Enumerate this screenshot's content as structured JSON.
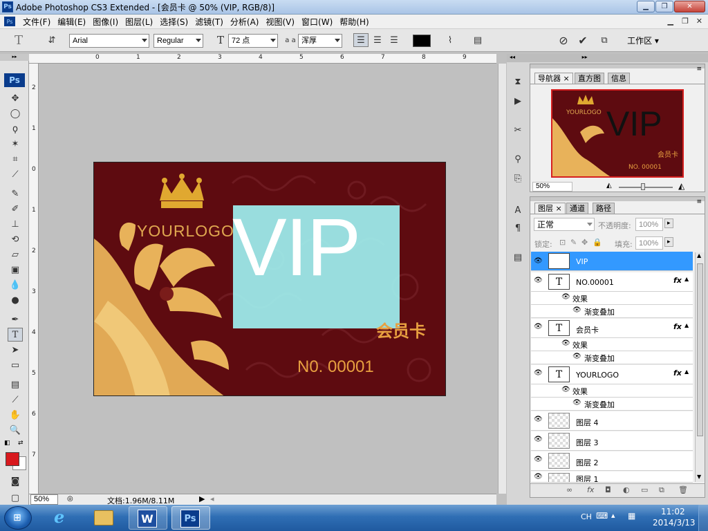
{
  "window": {
    "title": "Adobe Photoshop CS3 Extended - [会员卡 @ 50% (VIP, RGB/8)]",
    "app_icon": "Ps"
  },
  "menu": [
    "文件(F)",
    "编辑(E)",
    "图像(I)",
    "图层(L)",
    "选择(S)",
    "滤镜(T)",
    "分析(A)",
    "视图(V)",
    "窗口(W)",
    "帮助(H)"
  ],
  "options": {
    "tool_letter": "T",
    "font_family": "Arial",
    "font_style": "Regular",
    "font_size": "72 点",
    "aa_label": "a a",
    "anti_alias": "浑厚",
    "text_color": "#000000",
    "workspace": "工作区 ▾"
  },
  "canvas": {
    "zoom": "50%",
    "doc_size": "文档:1.96M/8.11M",
    "ruler_h": [
      "0",
      "1",
      "2",
      "3",
      "4",
      "5",
      "6",
      "7",
      "8",
      "9"
    ],
    "ruler_v": [
      "2",
      "1",
      "0",
      "1",
      "2",
      "3",
      "4",
      "5",
      "6",
      "7"
    ]
  },
  "card": {
    "logo": "YOURLOGO",
    "vip": "VIP",
    "member": "会员卡",
    "number": "N0. 00001",
    "bg_color": "#5e0b10",
    "gold": "#e8b25a",
    "highlight": "#9ef0f0"
  },
  "navigator": {
    "tabs": [
      "导航器",
      "直方图",
      "信息"
    ],
    "zoom": "50%",
    "preview": {
      "logo": "YOURLOGO",
      "vip": "VIP",
      "member": "会员卡",
      "number": "NO. 00001"
    }
  },
  "layers": {
    "tabs": [
      "图层",
      "通道",
      "路径"
    ],
    "blend_mode": "正常",
    "opacity_label": "不透明度:",
    "opacity": "100%",
    "lock_label": "锁定:",
    "fill_label": "填充:",
    "fill": "100%",
    "items": [
      {
        "name": "VIP",
        "type": "text",
        "selected": true
      },
      {
        "name": "NO.00001",
        "type": "text",
        "fx": "fx",
        "effects_label": "效果",
        "effect": "渐变叠加"
      },
      {
        "name": "会员卡",
        "type": "text",
        "fx": "fx",
        "effects_label": "效果",
        "effect": "渐变叠加"
      },
      {
        "name": "YOURLOGO",
        "type": "text",
        "fx": "fx",
        "effects_label": "效果",
        "effect": "渐变叠加"
      },
      {
        "name": "图层 4",
        "type": "pixel"
      },
      {
        "name": "图层 3",
        "type": "pixel"
      },
      {
        "name": "图层 2",
        "type": "pixel"
      },
      {
        "name": "图层 1",
        "type": "pixel"
      }
    ]
  },
  "taskbar": {
    "lang": "CH",
    "time": "11:02",
    "date": "2014/3/13",
    "apps": [
      "start-orb",
      "ie",
      "explorer",
      "word",
      "photoshop"
    ],
    "ps_label": "Ps",
    "word_label": "W"
  }
}
